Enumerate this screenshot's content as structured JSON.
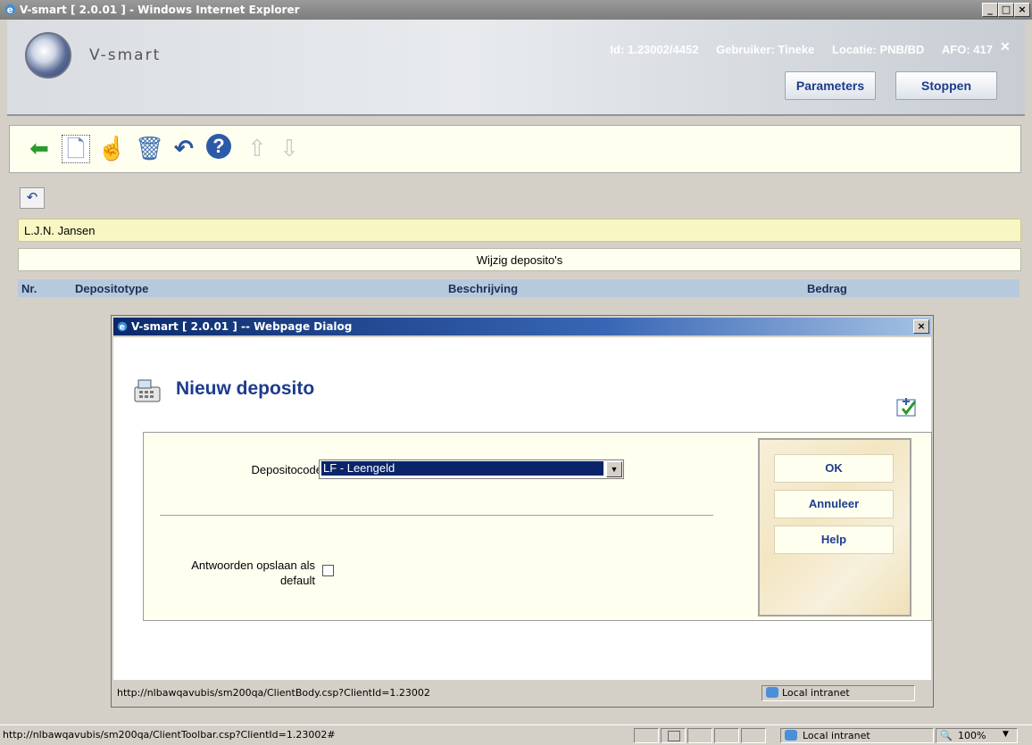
{
  "window": {
    "title": "V-smart [ 2.0.01 ] - Windows Internet Explorer",
    "minimize": "_",
    "maximize": "□",
    "close": "×"
  },
  "header": {
    "brand": "V-smart",
    "id": "Id: 1.23002/4452",
    "user": "Gebruiker: Tineke",
    "location": "Locatie: PNB/BD",
    "afo": "AFO: 417",
    "close": "✕",
    "parameters_label": "Parameters",
    "stop_label": "Stoppen"
  },
  "toolbar": {
    "icons": [
      "back-arrow-icon",
      "new-document-icon",
      "hand-select-icon",
      "delete-bin-icon",
      "undo-icon",
      "help-icon",
      "up-arrow-icon",
      "down-arrow-icon"
    ],
    "back": "⬅",
    "new": "🗋",
    "hand": "☝",
    "trash": "🗑",
    "undo": "↶",
    "help": "?",
    "up": "⇧",
    "down": "⇩"
  },
  "page": {
    "undo_small": "↶",
    "member_name": "L.J.N. Jansen",
    "page_title": "Wijzig deposito's",
    "table_headers": [
      "Nr.",
      "Depositotype",
      "Beschrijving",
      "Bedrag"
    ]
  },
  "dialog": {
    "title": "V-smart [ 2.0.01 ] -- Webpage Dialog",
    "close": "×",
    "heading": "Nieuw deposito",
    "deposit_code_label": "Depositocode",
    "deposit_code_value": "LF - Leengeld",
    "save_default_label_line1": "Antwoorden opslaan als",
    "save_default_label_line2": "default",
    "save_default_checked": false,
    "ok_label": "OK",
    "cancel_label": "Annuleer",
    "help_label": "Help",
    "status_url": "http://nlbawqavubis/sm200qa/ClientBody.csp?ClientId=1.23002",
    "zone": "Local intranet"
  },
  "statusbar": {
    "url": "http://nlbawqavubis/sm200qa/ClientToolbar.csp?ClientId=1.23002#",
    "zone": "Local intranet",
    "zoom": "100%"
  },
  "colors": {
    "accent": "#1c3c8c",
    "name_bar": "#f8f7c4",
    "table_header": "#b7c9dd",
    "dialog_title": "#0b2a6b"
  }
}
